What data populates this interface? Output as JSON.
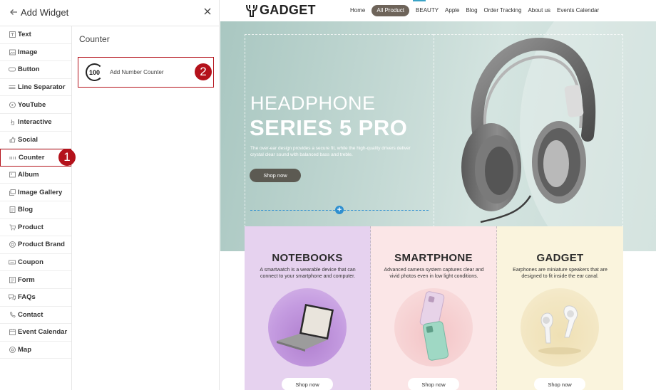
{
  "panel": {
    "title": "Add Widget",
    "categories": [
      {
        "label": "Text",
        "icon": "text-icon"
      },
      {
        "label": "Image",
        "icon": "image-icon"
      },
      {
        "label": "Button",
        "icon": "button-icon"
      },
      {
        "label": "Line Separator",
        "icon": "line-separator-icon"
      },
      {
        "label": "YouTube",
        "icon": "youtube-icon"
      },
      {
        "label": "Interactive",
        "icon": "interactive-icon"
      },
      {
        "label": "Social",
        "icon": "social-icon"
      },
      {
        "label": "Counter",
        "icon": "counter-icon",
        "active": true
      },
      {
        "label": "Album",
        "icon": "album-icon"
      },
      {
        "label": "Image Gallery",
        "icon": "image-gallery-icon"
      },
      {
        "label": "Blog",
        "icon": "blog-icon"
      },
      {
        "label": "Product",
        "icon": "product-icon"
      },
      {
        "label": "Product Brand",
        "icon": "product-brand-icon"
      },
      {
        "label": "Coupon",
        "icon": "coupon-icon"
      },
      {
        "label": "Form",
        "icon": "form-icon"
      },
      {
        "label": "FAQs",
        "icon": "faqs-icon"
      },
      {
        "label": "Contact",
        "icon": "contact-icon"
      },
      {
        "label": "Event Calendar",
        "icon": "event-calendar-icon"
      },
      {
        "label": "Map",
        "icon": "map-icon"
      }
    ],
    "detail_heading": "Counter",
    "widget": {
      "icon_text": "100",
      "label": "Add Number Counter"
    },
    "markers": {
      "first": "1",
      "second": "2"
    }
  },
  "site": {
    "logo": "GADGET",
    "nav": [
      {
        "label": "Home"
      },
      {
        "label": "All Product",
        "active": true
      },
      {
        "label": "BEAUTY"
      },
      {
        "label": "Apple"
      },
      {
        "label": "Blog"
      },
      {
        "label": "Order Tracking"
      },
      {
        "label": "About us"
      },
      {
        "label": "Events Calendar"
      }
    ],
    "hero": {
      "title_line1": "HEADPHONE",
      "title_line2": "SERIES 5 PRO",
      "description": "The over-ear design provides a secure fit, while the high-quality drivers deliver crystal clear sound with balanced bass and treble.",
      "button": "Shop now",
      "add_icon": "+"
    },
    "cards": [
      {
        "title": "NOTEBOOKS",
        "description": "A smartwatch is a wearable device that can connect to your smartphone and computer.",
        "button": "Shop now",
        "image": "laptop-image"
      },
      {
        "title": "SMARTPHONE",
        "description": "Advanced camera system captures clear and vivid photos even in low light conditions.",
        "button": "Shop now",
        "image": "smartphone-image"
      },
      {
        "title": "GADGET",
        "description": "Earphones are miniature speakers that are designed to fit inside the ear canal.",
        "button": "Shop now",
        "image": "earbuds-image"
      }
    ]
  },
  "colors": {
    "accent_red": "#b4121b",
    "hero_bg": "#c1d7d2",
    "nav_active": "#6e645a",
    "card_purple": "#e6d2ef",
    "card_pink": "#fbe6e7",
    "card_yellow": "#faf4dd",
    "edit_blue": "#2e8fd0"
  }
}
